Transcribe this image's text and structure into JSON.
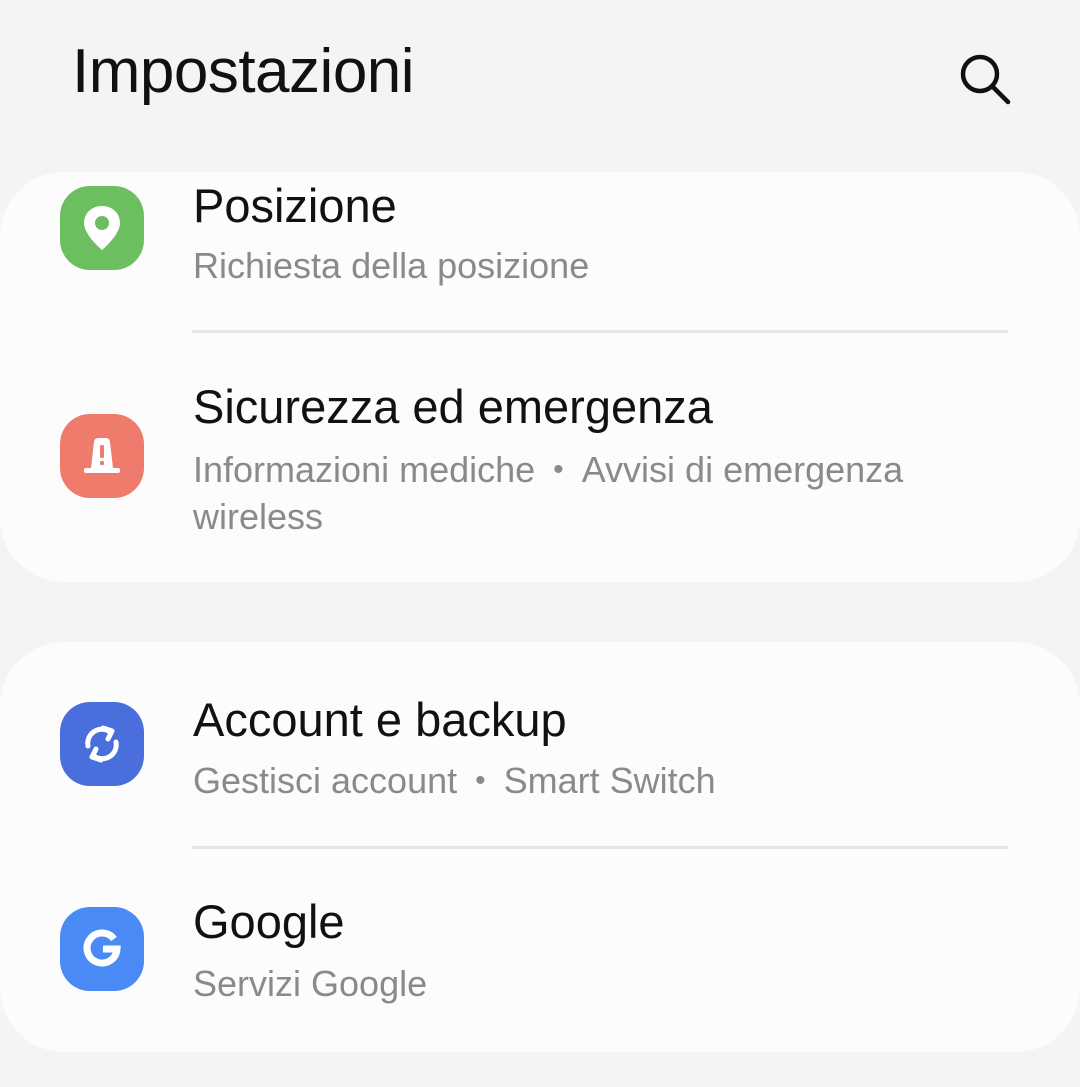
{
  "header": {
    "title": "Impostazioni",
    "search_icon": "search-icon"
  },
  "groups": [
    {
      "items": [
        {
          "title": "Posizione",
          "subtitle": "Richiesta della posizione",
          "icon": "location-pin-icon",
          "icon_color": "#6cbf5f"
        },
        {
          "title": "Sicurezza ed emergenza",
          "subtitle_parts": [
            "Informazioni mediche",
            "Avvisi di emergenza wireless"
          ],
          "icon": "emergency-siren-icon",
          "icon_color": "#ef7b6c"
        }
      ]
    },
    {
      "items": [
        {
          "title": "Account e backup",
          "subtitle_parts": [
            "Gestisci account",
            "Smart Switch"
          ],
          "icon": "sync-icon",
          "icon_color": "#4a6fdd"
        },
        {
          "title": "Google",
          "subtitle": "Servizi Google",
          "icon": "google-g-icon",
          "icon_color": "#4a8af4"
        }
      ]
    }
  ]
}
